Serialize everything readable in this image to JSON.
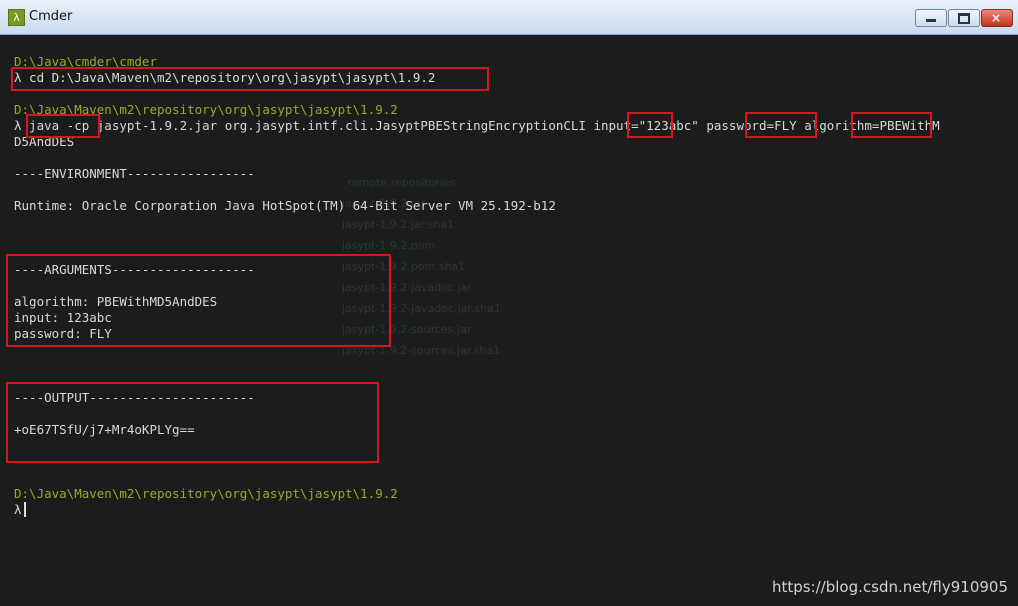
{
  "window": {
    "title": "Cmder",
    "app_icon": "λ"
  },
  "titlebar_buttons": {
    "close_glyph": "×"
  },
  "prompt_symbol": "λ",
  "terminal": {
    "path1": "D:\\Java\\cmder\\cmder",
    "cmd1": "λ cd D:\\Java\\Maven\\m2\\repository\\org\\jasypt\\jasypt\\1.9.2",
    "path2": "D:\\Java\\Maven\\m2\\repository\\org\\jasypt\\jasypt\\1.9.2",
    "cmd2_line1": "λ java -cp jasypt-1.9.2.jar org.jasypt.intf.cli.JasyptPBEStringEncryptionCLI input=\"123abc\" password=FLY algorithm=PBEWithM",
    "cmd2_line2": "D5AndDES",
    "env_header": "----ENVIRONMENT-----------------",
    "runtime": "Runtime: Oracle Corporation Java HotSpot(TM) 64-Bit Server VM 25.192-b12",
    "args_header": "----ARGUMENTS-------------------",
    "arg_algorithm": "algorithm: PBEWithMD5AndDES",
    "arg_input": "input: 123abc",
    "arg_password": "password: FLY",
    "output_header": "----OUTPUT----------------------",
    "output_value": "+oE67TSfU/j7+Mr4oKPLYg==",
    "path3": "D:\\Java\\Maven\\m2\\repository\\org\\jasypt\\jasypt\\1.9.2",
    "prompt": "λ"
  },
  "background_ghost": {
    "files": [
      "_remote.repositories",
      "jasypt-1.9.2.jar",
      "jasypt-1.9.2.jar.sha1",
      "jasypt-1.9.2.pom",
      "jasypt-1.9.2.pom.sha1",
      "jasypt-1.9.2-javadoc.jar",
      "jasypt-1.9.2-javadoc.jar.sha1",
      "jasypt-1.9.2-sources.jar",
      "jasypt-1.9.2-sources.jar.sha1"
    ]
  },
  "watermark": "https://blog.csdn.net/fly910905"
}
